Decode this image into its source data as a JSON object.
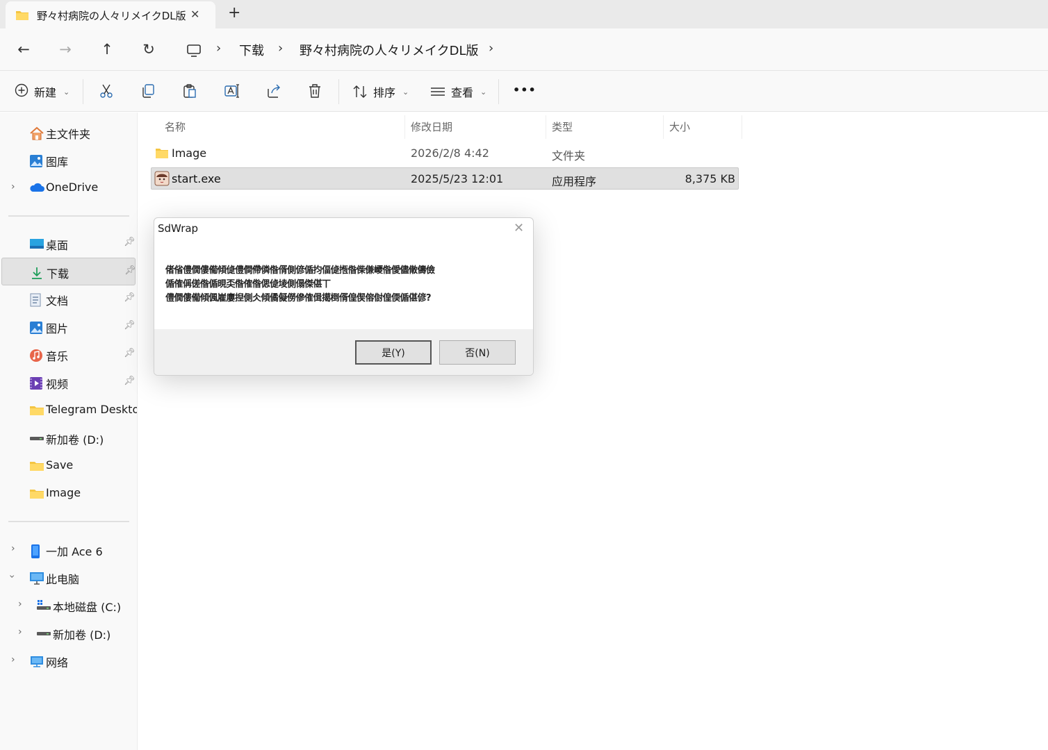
{
  "tab": {
    "title": "野々村病院の人々リメイクDL版",
    "new_tab": "+"
  },
  "nav": {
    "back": "←",
    "forward": "→",
    "up": "↑",
    "refresh": "↻",
    "breadcrumb": [
      "下载",
      "野々村病院の人々リメイクDL版"
    ],
    "separator": "›"
  },
  "commands": {
    "new_label": "新建",
    "sort_label": "排序",
    "view_label": "查看",
    "more": "•••"
  },
  "sidebar": {
    "top": [
      {
        "label": "主文件夹",
        "icon": "home-icon"
      },
      {
        "label": "图库",
        "icon": "gallery-icon"
      },
      {
        "label": "OneDrive",
        "icon": "cloud-icon"
      }
    ],
    "quick": [
      {
        "label": "桌面",
        "icon": "desktop-icon",
        "pinned": true
      },
      {
        "label": "下载",
        "icon": "download-icon",
        "pinned": true,
        "selected": true
      },
      {
        "label": "文档",
        "icon": "document-icon",
        "pinned": true
      },
      {
        "label": "图片",
        "icon": "picture-icon",
        "pinned": true
      },
      {
        "label": "音乐",
        "icon": "music-icon",
        "pinned": true
      },
      {
        "label": "视频",
        "icon": "video-icon",
        "pinned": true
      },
      {
        "label": "Telegram Desktop",
        "icon": "folder-icon"
      },
      {
        "label": "新加卷 (D:)",
        "icon": "drive-icon"
      },
      {
        "label": "Save",
        "icon": "folder-icon"
      },
      {
        "label": "Image",
        "icon": "folder-icon"
      }
    ],
    "devices": [
      {
        "label": "一加 Ace 6",
        "icon": "phone-icon"
      },
      {
        "label": "此电脑",
        "icon": "computer-icon"
      },
      {
        "label": "本地磁盘 (C:)",
        "icon": "windows-drive-icon"
      },
      {
        "label": "新加卷 (D:)",
        "icon": "drive-icon"
      },
      {
        "label": "网络",
        "icon": "network-icon"
      }
    ]
  },
  "filelist": {
    "columns": [
      "名称",
      "修改日期",
      "类型",
      "大小"
    ],
    "rows": [
      {
        "name": "Image",
        "date": "2026/2/8 4:42",
        "type": "文件夹",
        "size": ""
      },
      {
        "name": "start.exe",
        "date": "2025/5/23 12:01",
        "type": "应用程序",
        "size": "8,375 KB"
      }
    ]
  },
  "dialog": {
    "title": "SdWrap",
    "close": "✕",
    "message_lines": [
      "偖偗僼僩僂僃傾偼僼僴僀僯偺偦側偐偱抣偪偼揯偺偨傔巎偺僾儘僌儔儉",
      "偱傕偁傞偺偱晛奀偺傕偺偲偼堎側傝傑偡丅",
      "僼僩僂僃傾偑嵟廔揑側仌傾僪儗僗傪傕偮擖椡偦偟偰傛傠偟偄偱偡偐?"
    ],
    "yes_label": "是(Y)",
    "no_label": "否(N)"
  }
}
